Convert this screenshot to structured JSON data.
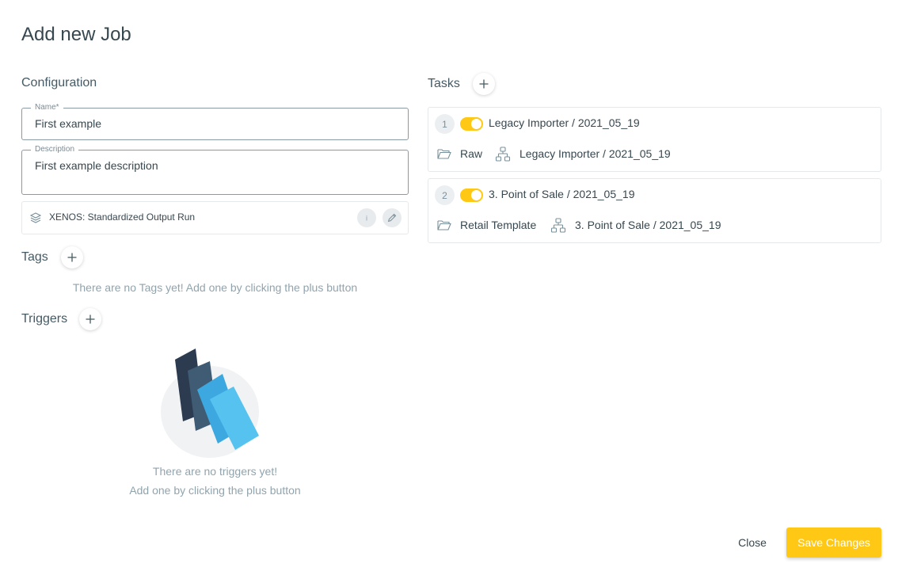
{
  "dialog": {
    "title": "Add new Job"
  },
  "configuration": {
    "title": "Configuration",
    "name": {
      "label": "Name*",
      "value": "First example"
    },
    "description": {
      "label": "Description",
      "value": "First example description"
    },
    "workflow": {
      "text": "XENOS: Standardized Output Run",
      "icon": "layers-icon",
      "info_icon": "info-icon",
      "edit_icon": "pencil-icon"
    }
  },
  "tags": {
    "title": "Tags",
    "empty": "There are no Tags yet! Add one by clicking the plus button"
  },
  "triggers": {
    "title": "Triggers",
    "empty_line1": "There are no triggers yet!",
    "empty_line2": "Add one by clicking the plus button"
  },
  "tasks": {
    "title": "Tasks",
    "items": [
      {
        "number": "1",
        "enabled": true,
        "title": "Legacy Importer / 2021_05_19",
        "folder": "Raw",
        "workflow": "Legacy Importer / 2021_05_19"
      },
      {
        "number": "2",
        "enabled": true,
        "title": "3. Point of Sale / 2021_05_19",
        "folder": "Retail Template",
        "workflow": "3. Point of Sale / 2021_05_19"
      }
    ]
  },
  "footer": {
    "close_label": "Close",
    "save_label": "Save Changes"
  },
  "colors": {
    "accent": "#ffc815",
    "muted_text": "#90a4ae",
    "text": "#37474f"
  }
}
